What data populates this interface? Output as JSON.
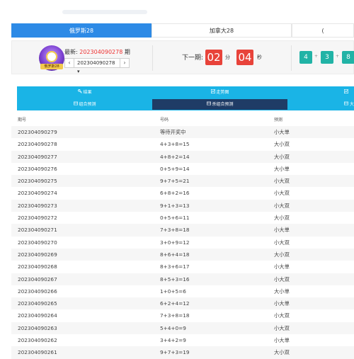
{
  "tabs": [
    {
      "label": "俄罗斯28"
    },
    {
      "label": "加拿大28"
    },
    {
      "label": "("
    }
  ],
  "draw": {
    "logo_text": "俄罗斯28",
    "latest_prefix": "最新: ",
    "latest_issue": "202304090278",
    "latest_suffix": " 期",
    "selected_issue": "202304090278",
    "dropdown_caret": "▾",
    "prev_symbol": "‹",
    "next_symbol": "›",
    "next_label": "下一期:",
    "countdown_minutes": "02",
    "minute_unit": "分",
    "countdown_seconds": "04",
    "second_unit": "秒",
    "result_numbers": [
      "4",
      "3",
      "8"
    ],
    "plus": "+"
  },
  "functions": {
    "row1": [
      {
        "label": "结果",
        "icon": "key-icon"
      },
      {
        "label": "走势图",
        "icon": "chart-icon"
      },
      {
        "label": "",
        "icon": "chart-icon"
      }
    ],
    "row2": [
      {
        "label": "组合预测",
        "icon": "grid-icon"
      },
      {
        "label": "杀组合预测",
        "icon": "grid-icon"
      },
      {
        "label": "大",
        "icon": "grid-icon"
      }
    ]
  },
  "table": {
    "headers": [
      "期号",
      "号码",
      "预测"
    ],
    "rows": [
      [
        "202304090279",
        "等待开奖中",
        "小大单"
      ],
      [
        "202304090278",
        "4+3+8=15",
        "大小双"
      ],
      [
        "202304090277",
        "4+8+2=14",
        "大小双"
      ],
      [
        "202304090276",
        "0+5+9=14",
        "大小单"
      ],
      [
        "202304090275",
        "9+7+5=21",
        "小大双"
      ],
      [
        "202304090274",
        "6+8+2=16",
        "小大双"
      ],
      [
        "202304090273",
        "9+1+3=13",
        "小大双"
      ],
      [
        "202304090272",
        "0+5+6=11",
        "大小双"
      ],
      [
        "202304090271",
        "7+3+8=18",
        "小大单"
      ],
      [
        "202304090270",
        "3+0+9=12",
        "小大双"
      ],
      [
        "202304090269",
        "8+6+4=18",
        "大小双"
      ],
      [
        "202304090268",
        "8+3+6=17",
        "小大单"
      ],
      [
        "202304090267",
        "8+5+3=16",
        "小大双"
      ],
      [
        "202304090266",
        "1+0+5=6",
        "大小单"
      ],
      [
        "202304090265",
        "6+2+4=12",
        "小大单"
      ],
      [
        "202304090264",
        "7+3+8=18",
        "小大双"
      ],
      [
        "202304090263",
        "5+4+0=9",
        "小大双"
      ],
      [
        "202304090262",
        "3+4+2=9",
        "小大单"
      ],
      [
        "202304090261",
        "9+7+3=19",
        "大小双"
      ]
    ]
  }
}
